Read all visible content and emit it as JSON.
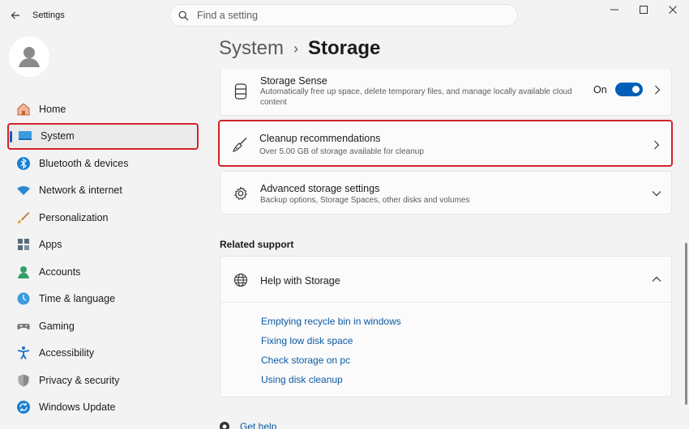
{
  "window": {
    "title": "Settings",
    "search_placeholder": "Find a setting"
  },
  "sidebar": {
    "items": [
      {
        "label": "Home",
        "icon": "home-icon"
      },
      {
        "label": "System",
        "icon": "monitor-icon",
        "selected": true
      },
      {
        "label": "Bluetooth & devices",
        "icon": "bluetooth-icon"
      },
      {
        "label": "Network & internet",
        "icon": "wifi-icon"
      },
      {
        "label": "Personalization",
        "icon": "brush-icon"
      },
      {
        "label": "Apps",
        "icon": "apps-icon"
      },
      {
        "label": "Accounts",
        "icon": "accounts-icon"
      },
      {
        "label": "Time & language",
        "icon": "globe-clock-icon"
      },
      {
        "label": "Gaming",
        "icon": "gamepad-icon"
      },
      {
        "label": "Accessibility",
        "icon": "accessibility-icon"
      },
      {
        "label": "Privacy & security",
        "icon": "shield-icon"
      },
      {
        "label": "Windows Update",
        "icon": "update-icon"
      }
    ]
  },
  "breadcrumb": {
    "parent": "System",
    "separator": "›",
    "current": "Storage"
  },
  "storage_sense": {
    "title": "Storage Sense",
    "desc_line1": "Automatically free up space, delete temporary files, and manage locally available cloud",
    "desc_line2": "content",
    "toggle_label": "On",
    "toggle_on": true
  },
  "cleanup": {
    "title": "Cleanup recommendations",
    "desc": "Over 5.00 GB of storage available for cleanup"
  },
  "advanced": {
    "title": "Advanced storage settings",
    "desc": "Backup options, Storage Spaces, other disks and volumes"
  },
  "related": {
    "heading": "Related support",
    "help_title": "Help with Storage",
    "links": [
      "Emptying recycle bin in windows",
      "Fixing low disk space",
      "Check storage on pc",
      "Using disk cleanup"
    ]
  },
  "footer": {
    "get_help": "Get help"
  },
  "colors": {
    "accent": "#005fb8",
    "highlight_red": "#d3222a",
    "link": "#0b5aa2"
  }
}
